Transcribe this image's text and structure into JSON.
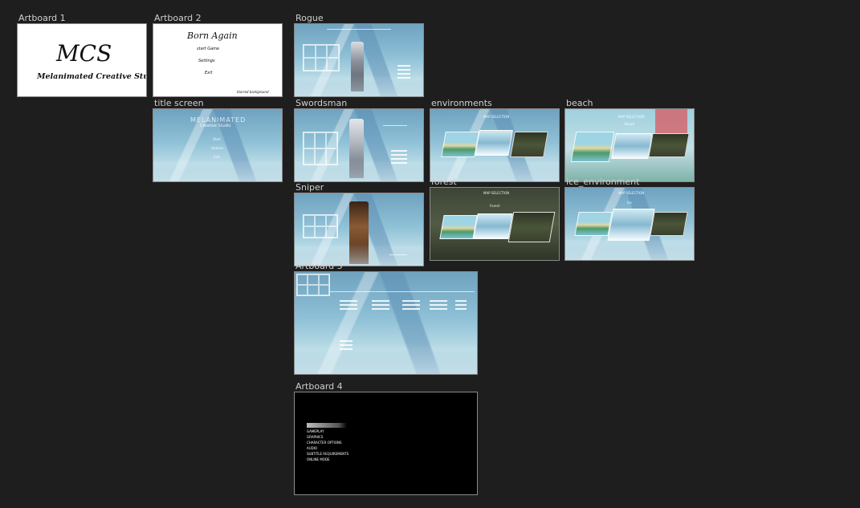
{
  "artboards": [
    {
      "key": "artboard1",
      "label": "Artboard 1"
    },
    {
      "key": "artboard2",
      "label": "Artboard 2"
    },
    {
      "key": "rogue",
      "label": "Rogue"
    },
    {
      "key": "title_screen",
      "label": "title screen"
    },
    {
      "key": "swordsman",
      "label": "Swordsman"
    },
    {
      "key": "environments",
      "label": "environments"
    },
    {
      "key": "beach",
      "label": "beach"
    },
    {
      "key": "sniper",
      "label": "Sniper"
    },
    {
      "key": "forest",
      "label": "forest"
    },
    {
      "key": "ice_environment",
      "label": "ice_environment"
    },
    {
      "key": "artboard3",
      "label": "Artboard 3"
    },
    {
      "key": "artboard4",
      "label": "Artboard 4"
    }
  ],
  "artboard1_content": {
    "logo_big": "MCS",
    "logo_sub": "Melanimated Creative Studio"
  },
  "artboard2_content": {
    "title": "Born Again",
    "items": [
      "start Game",
      "Settings",
      "Exit"
    ],
    "note": "blurred background"
  },
  "title_screen_content": {
    "title": "MELANIMATED",
    "subtitle": "Creative Studio",
    "items": [
      "Start",
      "Options",
      "Exit"
    ]
  },
  "environments_content": {
    "header": "MAP SELECTION"
  },
  "beach_content": {
    "header": "MAP SELECTION",
    "selected": "Beach"
  },
  "forest_content": {
    "header": "MAP SELECTION",
    "selected": "Forest"
  },
  "ice_content": {
    "header": "MAP SELECTION",
    "selected": "Ice"
  },
  "artboard4_content": {
    "menu": [
      "GAMEPLAY",
      "GRAPHICS",
      "CHARACTER OPTIONS",
      "AUDIO",
      "SUBTITLE REQUIREMENTS",
      "ONLINE MODE"
    ]
  },
  "colors": {
    "canvas_bg": "#1e1e1e",
    "label": "#cfcfcf",
    "ice": "#8ec0d6"
  }
}
